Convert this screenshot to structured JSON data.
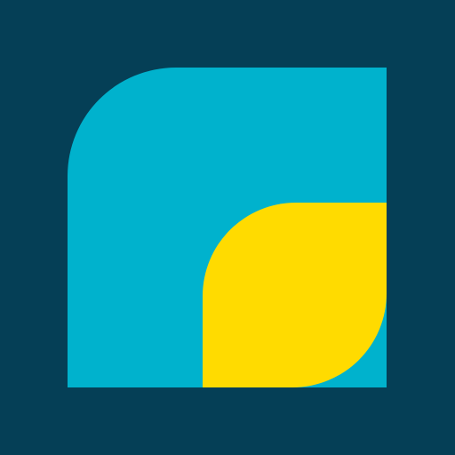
{
  "logo": {
    "icon": "leaf-mark-icon",
    "colors": {
      "background": "#053F56",
      "primary_shape": "#00B2CD",
      "accent_shape": "#FFDB00"
    }
  }
}
